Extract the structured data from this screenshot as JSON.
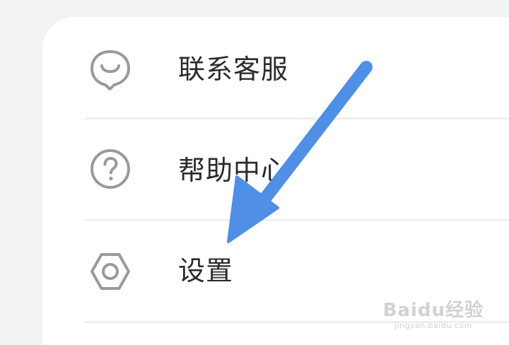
{
  "menu": {
    "items": [
      {
        "label": "联系客服",
        "icon": "customer-service-icon"
      },
      {
        "label": "帮助中心",
        "icon": "help-circle-icon"
      },
      {
        "label": "设置",
        "icon": "settings-icon"
      }
    ]
  },
  "annotation": {
    "arrow_color": "#4f8fe6"
  },
  "watermark": {
    "brand": "Baidu经验",
    "url": "jingyan.baidu.com"
  },
  "colors": {
    "background": "#f1f3f4",
    "card": "#ffffff",
    "icon_stroke": "#9a9a9a",
    "text": "#2b2b2b",
    "divider": "#efefef"
  }
}
